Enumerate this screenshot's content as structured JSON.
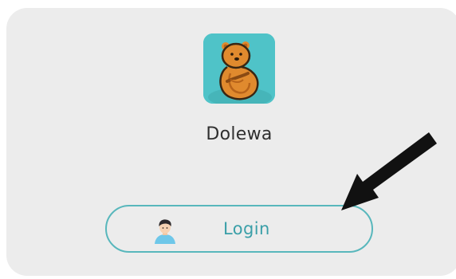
{
  "app": {
    "name": "Dolewa",
    "icon": "beaver-app-icon"
  },
  "login_button": {
    "label": "Login",
    "icon": "user-avatar-icon"
  },
  "annotation": {
    "icon": "arrow-pointer-icon"
  },
  "colors": {
    "card_background": "#ececec",
    "icon_background": "#4fc3c8",
    "button_border": "#58b7bc",
    "button_text": "#3a9fa8",
    "arrow": "#111111"
  }
}
